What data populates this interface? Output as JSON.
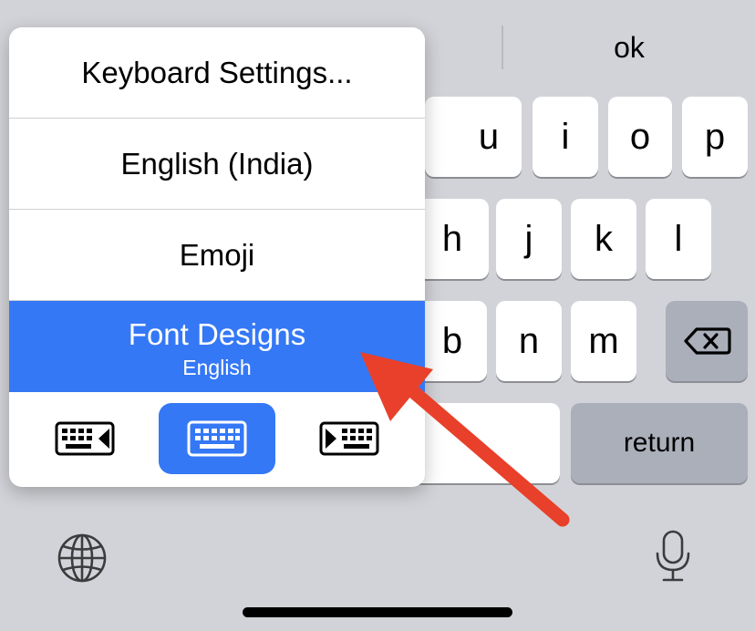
{
  "suggestions": {
    "right": "ok"
  },
  "keys": {
    "row1": [
      "u",
      "i",
      "o",
      "p"
    ],
    "row2": [
      "h",
      "j",
      "k",
      "l"
    ],
    "row3": [
      "b",
      "n",
      "m"
    ],
    "return_label": "return"
  },
  "popup": {
    "items": [
      {
        "label": "Keyboard Settings..."
      },
      {
        "label": "English (India)"
      },
      {
        "label": "Emoji"
      },
      {
        "label": "Font Designs",
        "sublabel": "English"
      }
    ],
    "selected_index": 3,
    "modes": [
      "keyboard-left",
      "keyboard-full",
      "keyboard-right"
    ],
    "active_mode": "keyboard-full"
  },
  "colors": {
    "keyboard_bg": "#d2d3d8",
    "highlight": "#3478f6",
    "arrow": "#e8402a",
    "dark_key": "#abafba"
  }
}
